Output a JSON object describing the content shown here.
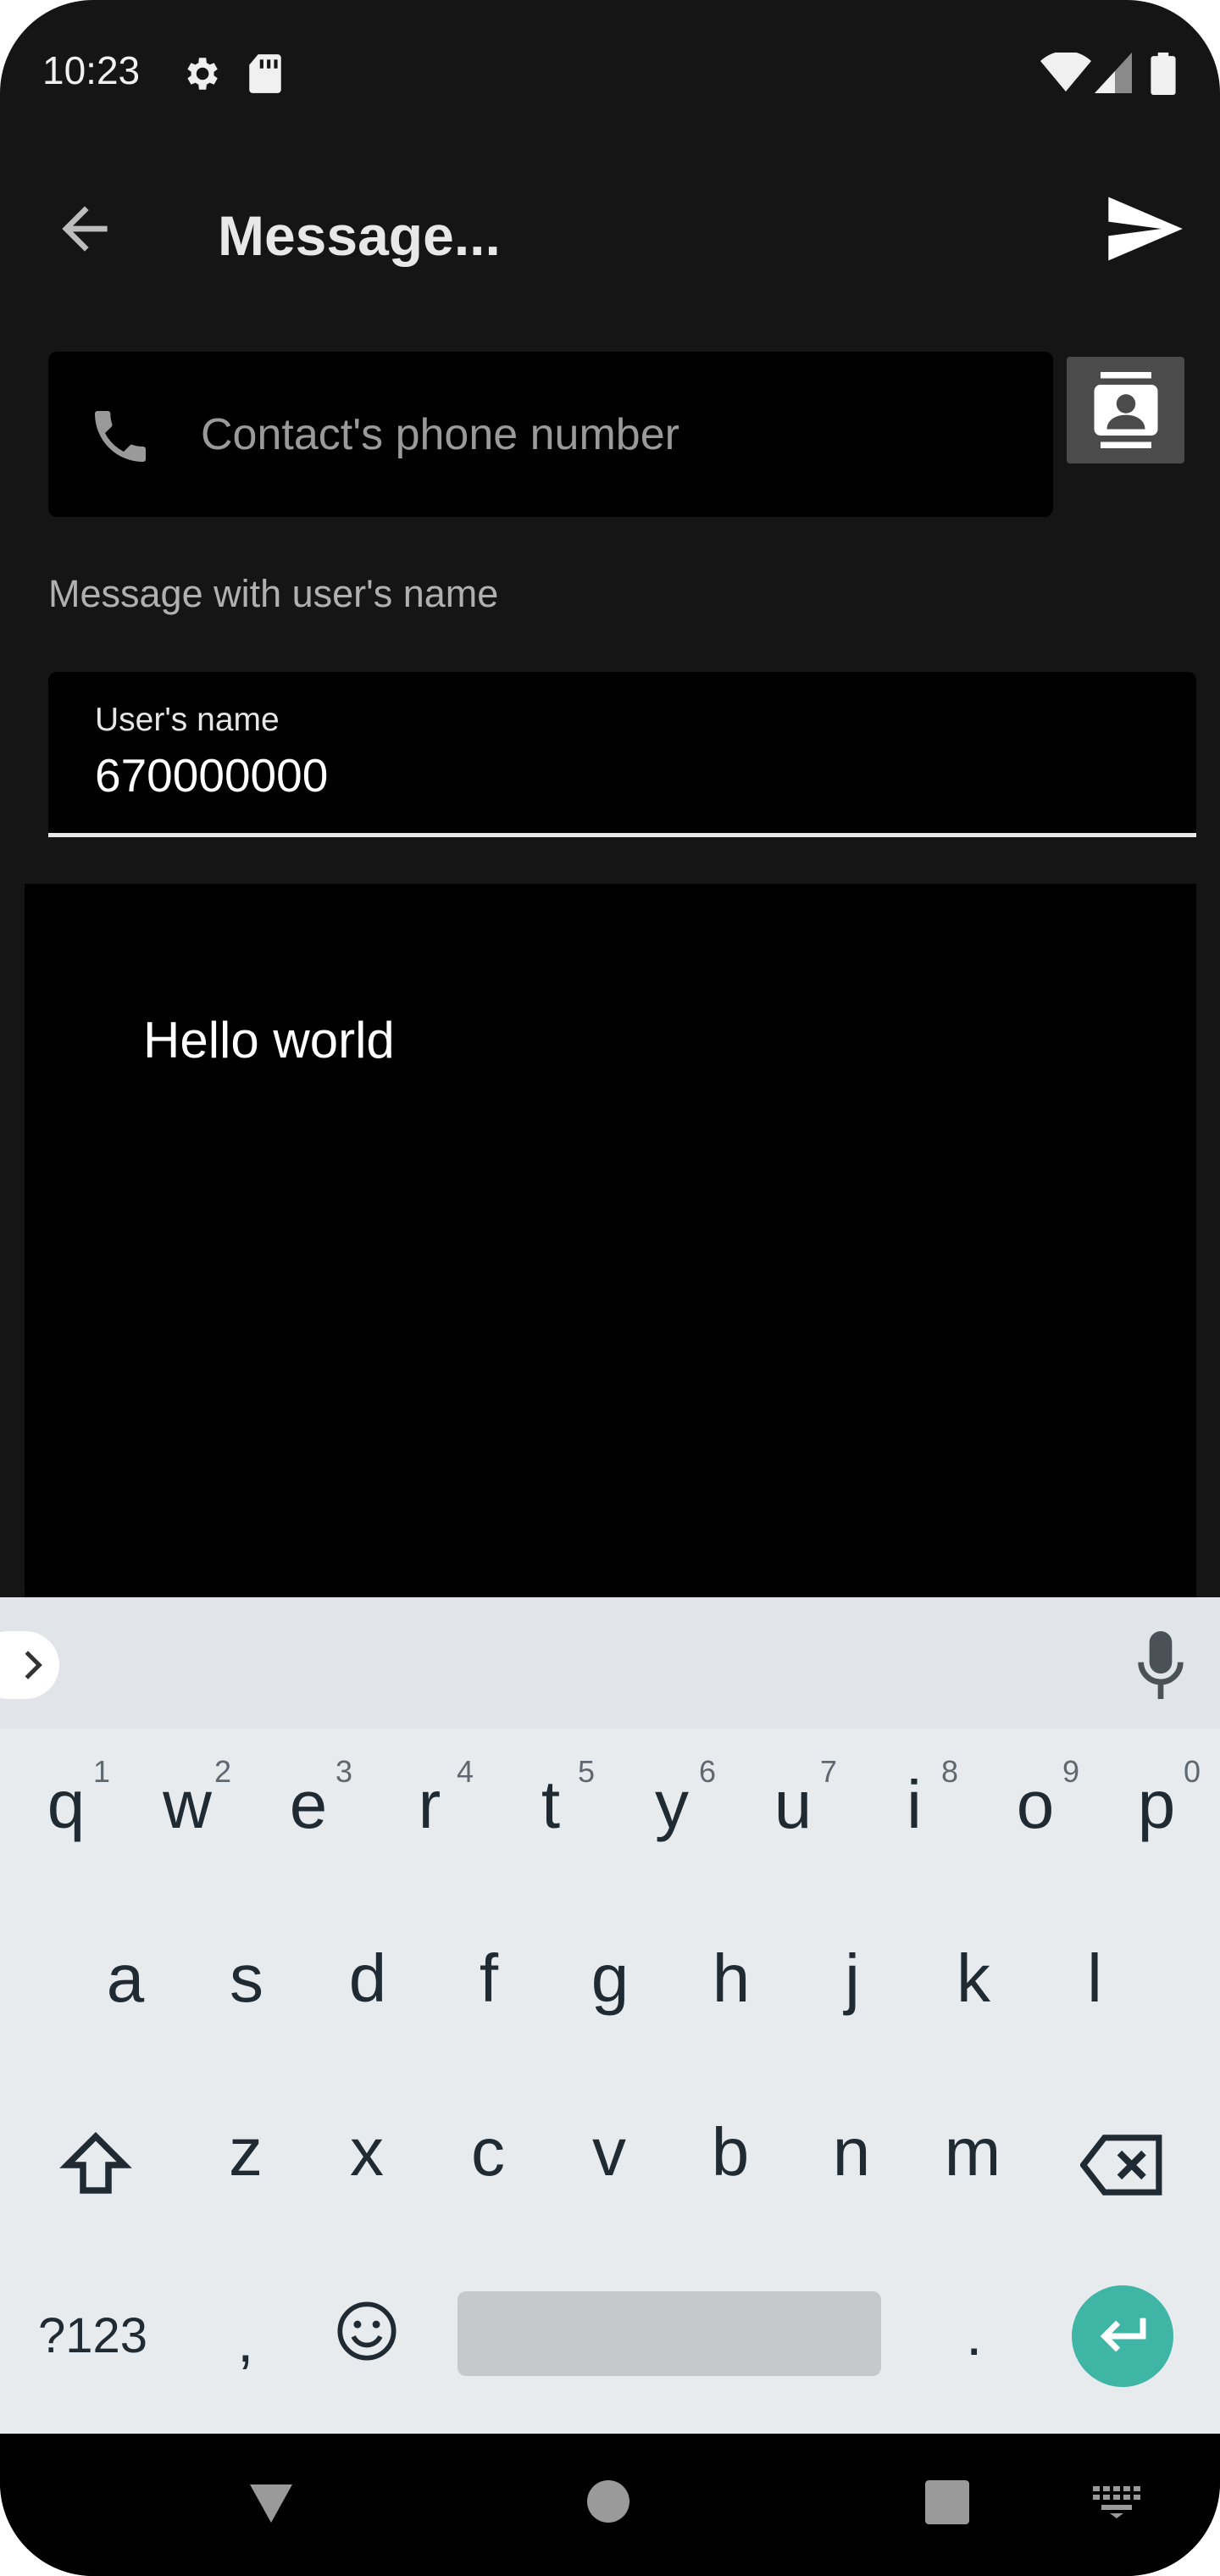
{
  "status_bar": {
    "time": "10:23",
    "icons": [
      "gear-icon",
      "sd-card-icon",
      "wifi-icon",
      "signal-icon",
      "battery-icon"
    ]
  },
  "app_bar": {
    "title": "Message...",
    "back_icon": "arrow-left-icon",
    "send_icon": "send-icon"
  },
  "form": {
    "phone_placeholder": "Contact's phone number",
    "contacts_icon": "contacts-book-icon",
    "section_label": "Message with user's name",
    "name_label": "User's name",
    "name_value": "670000000",
    "message_text": "Hello world"
  },
  "keyboard": {
    "row1": [
      {
        "key": "q",
        "hint": "1"
      },
      {
        "key": "w",
        "hint": "2"
      },
      {
        "key": "e",
        "hint": "3"
      },
      {
        "key": "r",
        "hint": "4"
      },
      {
        "key": "t",
        "hint": "5"
      },
      {
        "key": "y",
        "hint": "6"
      },
      {
        "key": "u",
        "hint": "7"
      },
      {
        "key": "i",
        "hint": "8"
      },
      {
        "key": "o",
        "hint": "9"
      },
      {
        "key": "p",
        "hint": "0"
      }
    ],
    "row2": [
      "a",
      "s",
      "d",
      "f",
      "g",
      "h",
      "j",
      "k",
      "l"
    ],
    "row3": [
      "z",
      "x",
      "c",
      "v",
      "b",
      "n",
      "m"
    ],
    "symbols_label": "?123",
    "comma_label": ",",
    "period_label": ".",
    "accent_color": "#3fb5a5"
  },
  "colors": {
    "background": "#151515",
    "field": "#000000",
    "keyboard": "#e8ebee"
  }
}
